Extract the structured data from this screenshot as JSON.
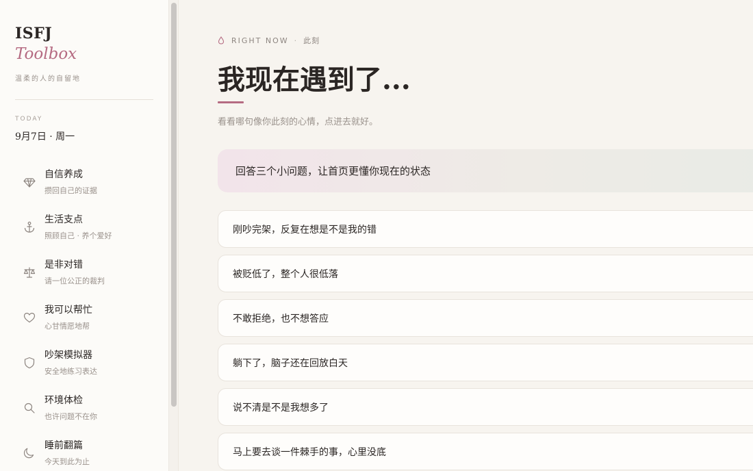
{
  "brand": {
    "title": "ISFJ",
    "subtitle": "Toolbox",
    "tagline": "温柔的人的自留地"
  },
  "today": {
    "label": "TODAY",
    "date": "9月7日 · 周一"
  },
  "sidebar": {
    "items": [
      {
        "label": "自信养成",
        "desc": "攒回自己的证据",
        "icon": "diamond-icon"
      },
      {
        "label": "生活支点",
        "desc": "照顾自己 · 养个爱好",
        "icon": "anchor-icon"
      },
      {
        "label": "是非对错",
        "desc": "请一位公正的裁判",
        "icon": "scales-icon"
      },
      {
        "label": "我可以帮忙",
        "desc": "心甘情愿地帮",
        "icon": "heart-icon"
      },
      {
        "label": "吵架模拟器",
        "desc": "安全地练习表达",
        "icon": "shield-icon"
      },
      {
        "label": "环境体检",
        "desc": "也许问题不在你",
        "icon": "search-icon"
      },
      {
        "label": "睡前翻篇",
        "desc": "今天到此为止",
        "icon": "moon-icon"
      }
    ]
  },
  "main": {
    "eyebrow_en": "RIGHT NOW",
    "eyebrow_sep": "·",
    "eyebrow_cn": "此刻",
    "title": "我现在遇到了...",
    "subtitle": "看看哪句像你此刻的心情，点进去就好。",
    "quiz_banner": "回答三个小问题，让首页更懂你现在的状态",
    "situations": [
      "刚吵完架，反复在想是不是我的错",
      "被贬低了，整个人很低落",
      "不敢拒绝，也不想答应",
      "躺下了，脑子还在回放白天",
      "说不清是不是我想多了",
      "马上要去谈一件棘手的事，心里没底"
    ]
  },
  "colors": {
    "accent": "#b56b82",
    "background": "#f7f4ef",
    "sidebar": "#fcfbf8"
  }
}
